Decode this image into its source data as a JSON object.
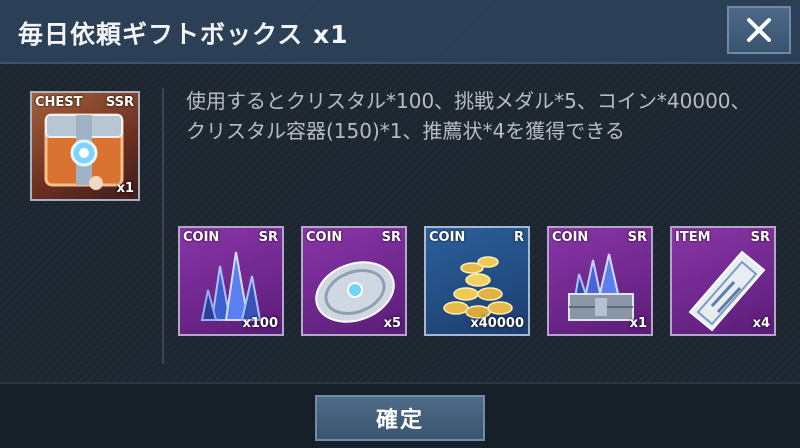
{
  "dialog": {
    "title": "毎日依頼ギフトボックス x1",
    "close_label": "X",
    "confirm_label": "確定"
  },
  "chest": {
    "label": "CHEST",
    "rarity": "SSR",
    "quantity": "x1"
  },
  "description": "使用するとクリスタル*100、挑戦メダル*5、コイン*40000、クリスタル容器(150)*1、推薦状*4を獲得できる",
  "rewards": [
    {
      "type": "COIN",
      "rarity": "SR",
      "quantity": "x100",
      "icon": "crystal-cluster-icon",
      "color": "#7a2e9c"
    },
    {
      "type": "COIN",
      "rarity": "SR",
      "quantity": "x5",
      "icon": "challenge-medal-icon",
      "color": "#7a2e9c"
    },
    {
      "type": "COIN",
      "rarity": "R",
      "quantity": "x40000",
      "icon": "gold-coins-icon",
      "color": "#2b5f9c"
    },
    {
      "type": "COIN",
      "rarity": "SR",
      "quantity": "x1",
      "icon": "crystal-container-icon",
      "color": "#7a2e9c"
    },
    {
      "type": "ITEM",
      "rarity": "SR",
      "quantity": "x4",
      "icon": "reference-letter-icon",
      "color": "#7a2e9c"
    }
  ]
}
